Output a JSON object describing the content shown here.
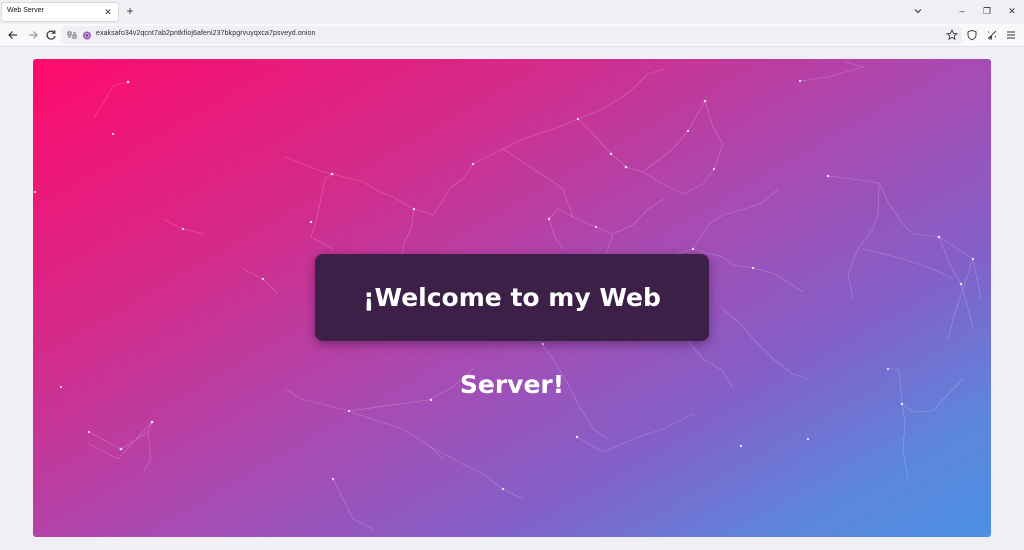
{
  "tab": {
    "title": "Web Server",
    "close_glyph": "✕",
    "new_tab_glyph": "+"
  },
  "window_controls": {
    "minimize": "–",
    "restore": "❐",
    "close": "✕"
  },
  "nav": {
    "back_icon": "arrow-left-icon",
    "forward_icon": "arrow-right-icon",
    "reload_icon": "reload-icon"
  },
  "urlbar": {
    "url": "exaksafo34v2qcnt7ab2pntkfioj6afeni237bkpgrvuyqxca7psveyd.onion"
  },
  "toolbar": {
    "bookmark_icon": "star-icon",
    "shield_icon": "shield-icon",
    "extensions_icon": "broom-icon",
    "menu_icon": "hamburger-menu-icon"
  },
  "page": {
    "heading": "¡Welcome to my Web Server!",
    "gradient_colors": [
      "#ff0a6c",
      "#d22c8c",
      "#a94ab1",
      "#8360c8",
      "#4b90e2"
    ],
    "box_color": "#3c2048"
  }
}
